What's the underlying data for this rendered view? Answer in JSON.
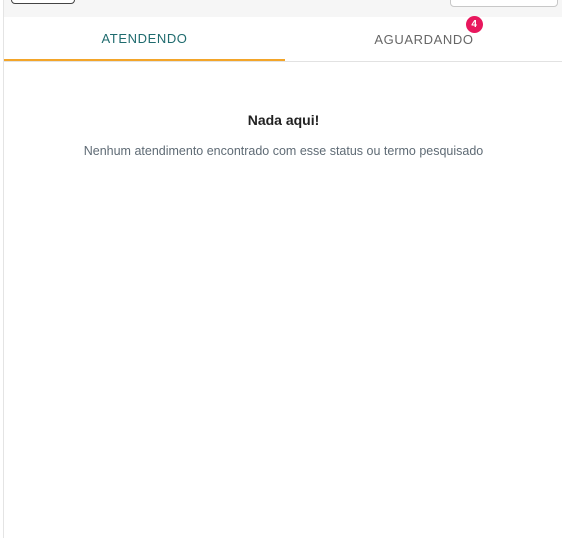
{
  "tabs": [
    {
      "label": "ATENDENDO",
      "active": true
    },
    {
      "label": "AGUARDANDO",
      "badge": "4"
    }
  ],
  "empty_state": {
    "title": "Nada aqui!",
    "description": "Nenhum atendimento encontrado com esse status ou termo pesquisado"
  },
  "colors": {
    "active_tab_text": "#1f6b6e",
    "active_tab_underline": "#f3a529",
    "badge": "#e8175d"
  }
}
